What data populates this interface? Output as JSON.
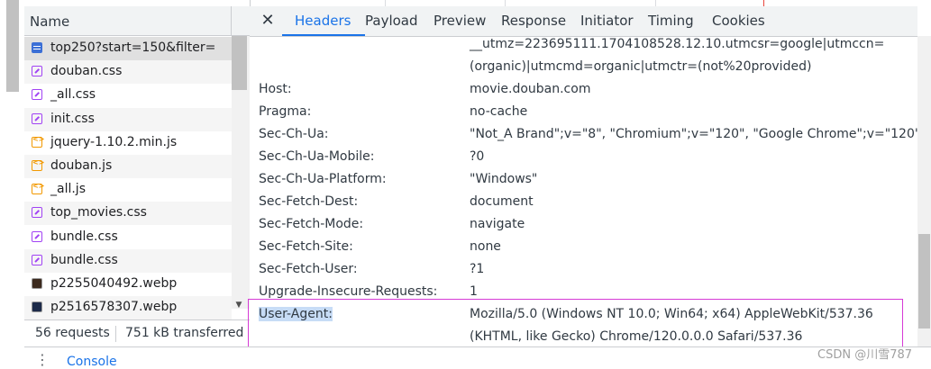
{
  "list": {
    "column_header": "Name",
    "items": [
      {
        "label": "top250?start=150&filter=",
        "type": "doc",
        "icon": "document-icon"
      },
      {
        "label": "douban.css",
        "type": "css",
        "icon": "stylesheet-icon"
      },
      {
        "label": "_all.css",
        "type": "css",
        "icon": "stylesheet-icon"
      },
      {
        "label": "init.css",
        "type": "css",
        "icon": "stylesheet-icon"
      },
      {
        "label": "jquery-1.10.2.min.js",
        "type": "js",
        "icon": "script-icon"
      },
      {
        "label": "douban.js",
        "type": "js",
        "icon": "script-icon"
      },
      {
        "label": "_all.js",
        "type": "js",
        "icon": "script-icon"
      },
      {
        "label": "top_movies.css",
        "type": "css",
        "icon": "stylesheet-icon"
      },
      {
        "label": "bundle.css",
        "type": "css",
        "icon": "stylesheet-icon"
      },
      {
        "label": "bundle.css",
        "type": "css",
        "icon": "stylesheet-icon"
      },
      {
        "label": "p2255040492.webp",
        "type": "img",
        "icon": "image-thumbnail-icon"
      },
      {
        "label": "p2516578307.webp",
        "type": "img",
        "icon": "image-thumbnail-icon"
      }
    ],
    "status": {
      "requests": "56 requests",
      "transferred": "751 kB transferred"
    }
  },
  "tabs": [
    "Headers",
    "Payload",
    "Preview",
    "Response",
    "Initiator",
    "Timing",
    "Cookies"
  ],
  "active_tab": "Headers",
  "headers": {
    "cookie_continuation": [
      "__utmz=223695111.1704108528.12.10.utmcsr=google|utmccn=",
      "(organic)|utmcmd=organic|utmctr=(not%20provided)"
    ],
    "rows": [
      {
        "name": "Host:",
        "value": "movie.douban.com"
      },
      {
        "name": "Pragma:",
        "value": "no-cache"
      },
      {
        "name": "Sec-Ch-Ua:",
        "value": "\"Not_A Brand\";v=\"8\", \"Chromium\";v=\"120\", \"Google Chrome\";v=\"120\""
      },
      {
        "name": "Sec-Ch-Ua-Mobile:",
        "value": "?0"
      },
      {
        "name": "Sec-Ch-Ua-Platform:",
        "value": "\"Windows\""
      },
      {
        "name": "Sec-Fetch-Dest:",
        "value": "document"
      },
      {
        "name": "Sec-Fetch-Mode:",
        "value": "navigate"
      },
      {
        "name": "Sec-Fetch-Site:",
        "value": "none"
      },
      {
        "name": "Sec-Fetch-User:",
        "value": "?1"
      },
      {
        "name": "Upgrade-Insecure-Requests:",
        "value": "1"
      }
    ],
    "user_agent": {
      "name": "User-Agent:",
      "value_line1": "Mozilla/5.0 (Windows NT 10.0; Win64; x64) AppleWebKit/537.36",
      "value_line2": "(KHTML, like Gecko) Chrome/120.0.0.0 Safari/537.36"
    }
  },
  "drawer": {
    "console_tab": "Console"
  },
  "watermark": "CSDN @川雪787",
  "colors": {
    "accent": "#1a73e8",
    "highlight_box": "#d63ad6",
    "selected_row": "#e0e0e0"
  }
}
